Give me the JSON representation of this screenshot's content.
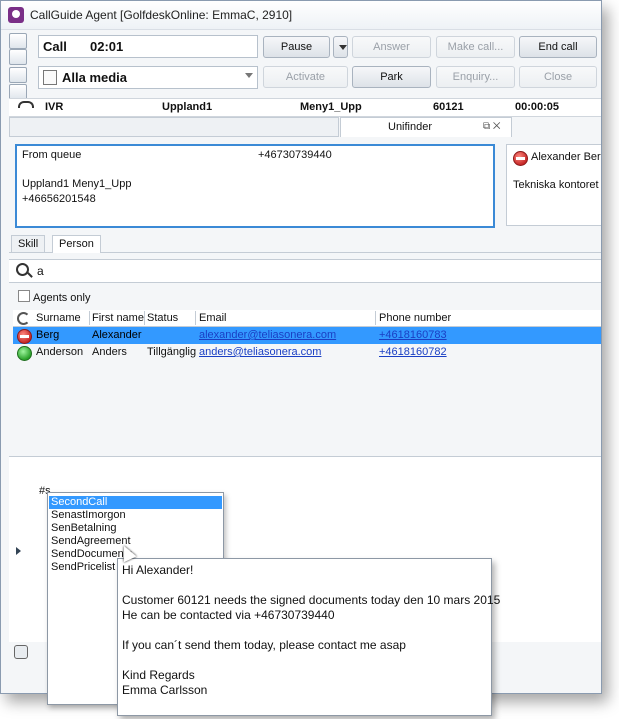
{
  "window": {
    "title": "CallGuide Agent [GolfdeskOnline: EmmaC, 2910]"
  },
  "call": {
    "label": "Call",
    "timer": "02:01"
  },
  "media": {
    "selected": "Alla media"
  },
  "buttons": {
    "pause": "Pause",
    "answer": "Answer",
    "make_call": "Make call...",
    "end_call": "End call",
    "activate": "Activate",
    "park": "Park",
    "enquiry": "Enquiry...",
    "close": "Close"
  },
  "info_row": {
    "channel": "IVR",
    "location": "Uppland1",
    "menu": "Meny1_Upp",
    "id": "60121",
    "duration": "00:00:05"
  },
  "tabs": {
    "unifinder": "Unifinder"
  },
  "queue_panel": {
    "line1_label": "From queue",
    "line1_number": "+46730739440",
    "line2": "Uppland1  Meny1_Upp",
    "line3": "+46656201548"
  },
  "agent_panel": {
    "name": "Alexander Berg",
    "office": "Tekniska kontoret tes"
  },
  "subtabs": [
    "Skill",
    "Person"
  ],
  "search": {
    "value": "a"
  },
  "agents_only": {
    "label": "Agents only",
    "checked": false
  },
  "table": {
    "columns": [
      "Surname",
      "First name",
      "Status",
      "Email",
      "Phone number"
    ],
    "rows": [
      {
        "surname": "Berg",
        "first_name": "Alexander",
        "status": "",
        "email": "alexander@teliasonera.com",
        "phone": "+4618160783",
        "presence": "busy"
      },
      {
        "surname": "Anderson",
        "first_name": "Anders",
        "status": "Tillgänglig",
        "email": "anders@teliasonera.com",
        "phone": "+4618160782",
        "presence": "available"
      }
    ]
  },
  "chat": {
    "input_text": "#s"
  },
  "suggestions": [
    "SecondCall",
    "SenastImorgon",
    "SenBetalning",
    "SendAgreement",
    "SendDocuments",
    "SendPricelist"
  ],
  "tooltip_lines": [
    "Hi Alexander!",
    "",
    "Customer 60121 needs the signed documents today den 10 mars 2015",
    "He can be contacted via +46730739440",
    "",
    "If you can´t send them today, please contact me asap",
    "",
    "Kind Regards",
    "Emma Carlsson"
  ],
  "colors": {
    "selection": "#3399ff",
    "focus_border": "#3b8ad6",
    "link": "#1a3fc4",
    "app_icon": "#7a2f87"
  }
}
